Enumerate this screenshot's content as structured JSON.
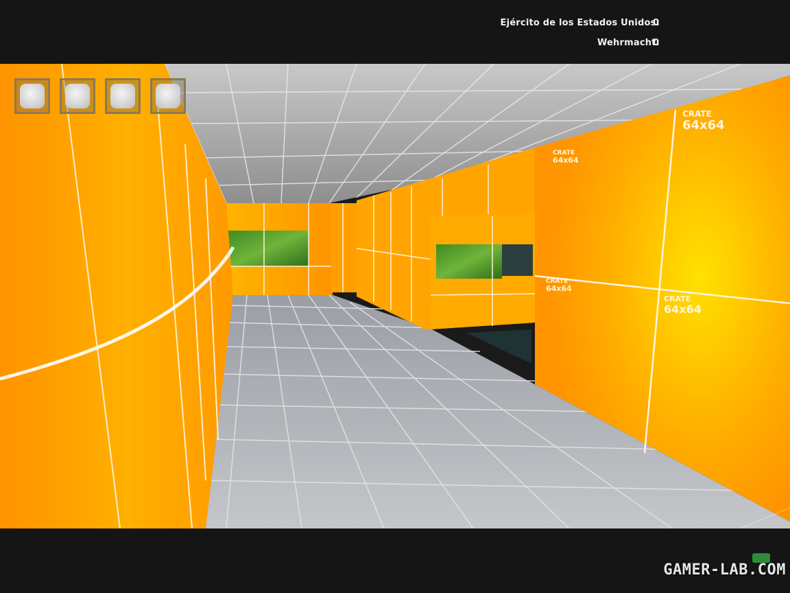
{
  "scoreboard": {
    "allies_label": "Ejército de los Estados Unidos:",
    "allies_score": "0",
    "axis_label": "Wehrmacht:",
    "axis_score": "0"
  },
  "inventory_slots": [
    {
      "icon": "empty-slot-icon"
    },
    {
      "icon": "empty-slot-icon"
    },
    {
      "icon": "empty-slot-icon"
    },
    {
      "icon": "empty-slot-icon"
    }
  ],
  "watermark": "GAMER-LAB.COM",
  "wall_labels": {
    "crate": "CRATE",
    "size": "64x64"
  },
  "colors": {
    "wall_orange": "#ff9a00",
    "wall_yellow": "#ffd400",
    "floor_grey": "#a9adb3",
    "hud_bar": "#161616"
  }
}
